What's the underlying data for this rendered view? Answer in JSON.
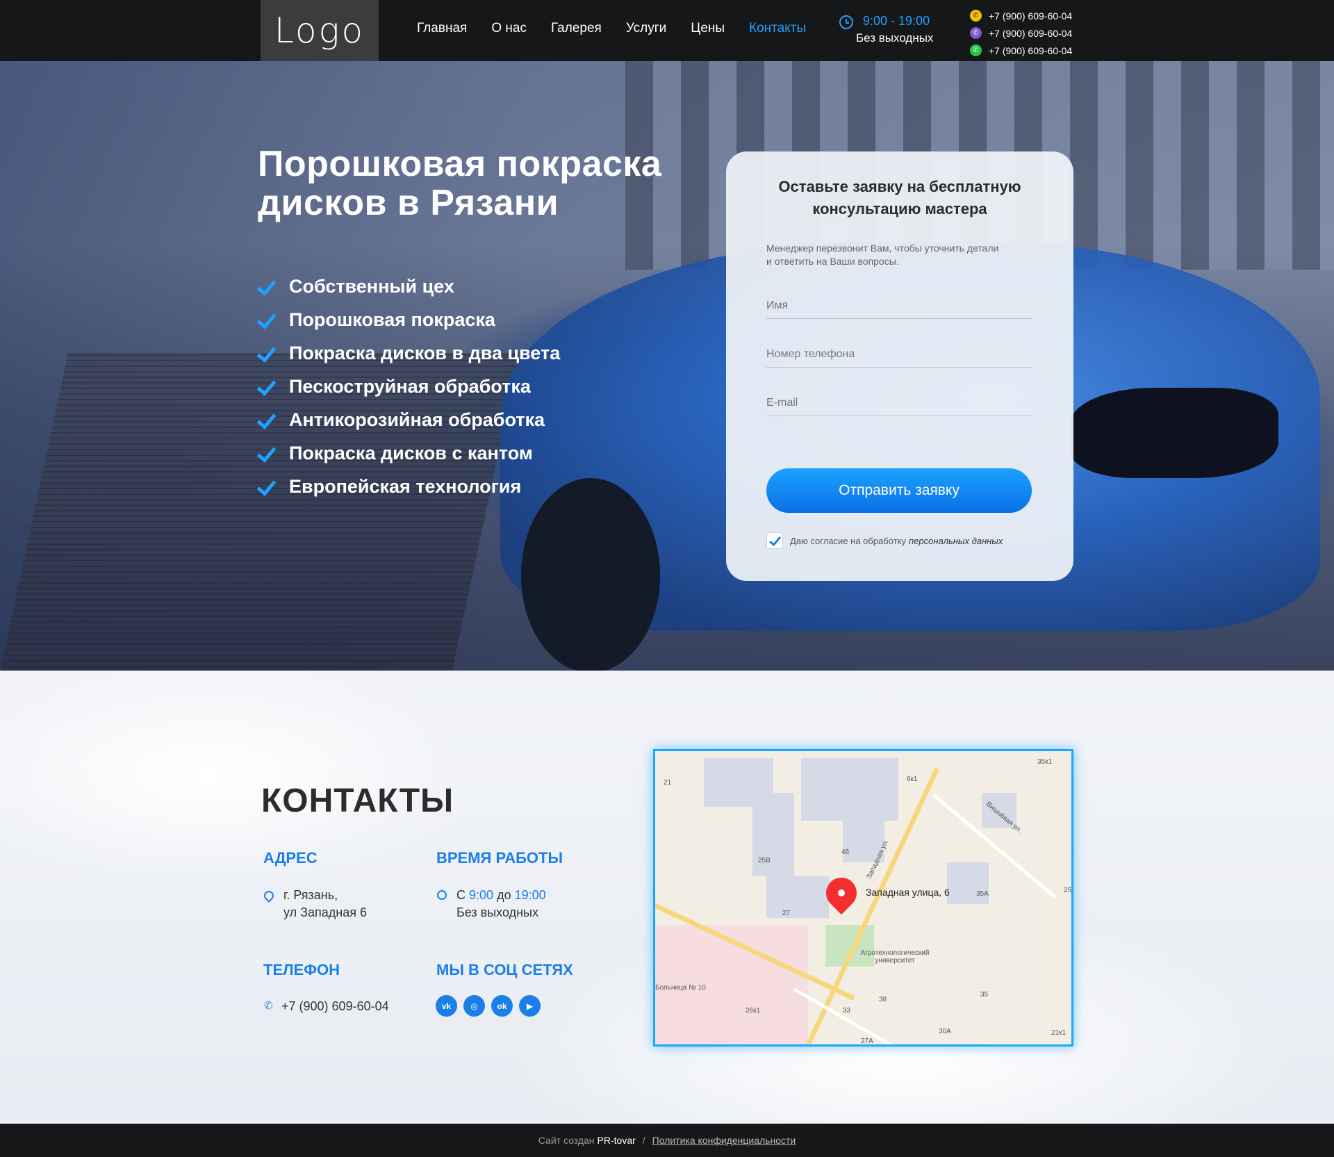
{
  "header": {
    "logo": "Logo",
    "nav": [
      "Главная",
      "О нас",
      "Галерея",
      "Услуги",
      "Цены",
      "Контакты"
    ],
    "hours_time": "9:00 - 19:00",
    "hours_days": "Без выходных",
    "phones": [
      "+7 (900) 609-60-04",
      "+7 (900) 609-60-04",
      "+7 (900) 609-60-04"
    ]
  },
  "hero": {
    "title": "Порошковая покраска дисков в Рязани",
    "features": [
      "Собственный цех",
      "Порошковая покраска",
      "Покраска дисков в два цвета",
      "Пескоструйная обработка",
      "Антикорозийная обработка",
      "Покраска дисков с кантом",
      "Европейская технология"
    ]
  },
  "form": {
    "title": "Оставьте заявку на бесплатную консультацию мастера",
    "subtitle": "Менеджер перезвонит Вам, чтобы уточнить детали и ответить на Ваши вопросы.",
    "name_placeholder": "Имя",
    "phone_placeholder": "Номер телефона",
    "email_placeholder": "E-mail",
    "submit": "Отправить заявку",
    "consent_text": "Даю согласие на обработку",
    "consent_link": "персональных данных"
  },
  "contacts": {
    "title": "КОНТАКТЫ",
    "address_head": "АДРЕС",
    "address_line1": "г. Рязань,",
    "address_line2": "ул Западная 6",
    "hours_head": "ВРЕМЯ РАБОТЫ",
    "hours_prefix": "С",
    "hours_from": "9:00",
    "hours_mid": "до",
    "hours_to": "19:00",
    "hours_days": "Без выходных",
    "phone_head": "ТЕЛЕФОН",
    "phone": "+7 (900) 609-60-04",
    "social_head": "МЫ В СОЦ СЕТЯХ",
    "social_icons": [
      "vk-icon",
      "instagram-icon",
      "odnoklassniki-icon",
      "youtube-icon"
    ]
  },
  "map": {
    "pin_label": "Западная улица, 6",
    "poi_university": "Агротехнологический университет",
    "poi_hospital": "Больница № 10",
    "street_zapadnaya": "Западная ул.",
    "street_vishnevaya": "Вишнёвая ул.",
    "house_numbers": [
      "21",
      "6к1",
      "35к1",
      "46",
      "25В",
      "27",
      "35А",
      "25",
      "26к1",
      "33",
      "38",
      "35",
      "30А",
      "27А",
      "21к1"
    ]
  },
  "footer": {
    "created_by": "Сайт создан",
    "brand": "PR-tovar",
    "separator": "/",
    "policy": "Политика конфиденциальности"
  },
  "colors": {
    "accent": "#1fa1ff",
    "accent_dark": "#1a7fe8",
    "header_bg": "#161718",
    "map_border": "#1aa7ff",
    "map_pin": "#f42e2e"
  }
}
